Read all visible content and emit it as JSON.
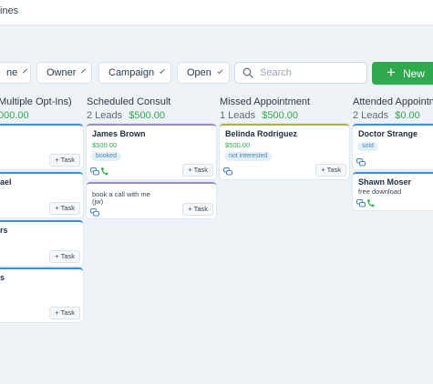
{
  "header": {
    "title": "ines"
  },
  "filters": {
    "chips": [
      {
        "key": "chip-0",
        "label": "ne"
      },
      {
        "key": "owner",
        "label": "Owner"
      },
      {
        "key": "campaign",
        "label": "Campaign"
      },
      {
        "key": "status",
        "label": "Open"
      }
    ],
    "search_placeholder": "Search",
    "new_label": "New"
  },
  "columns": [
    {
      "name": "Multiple Opt-Ins)",
      "count": "",
      "amount": "000.00",
      "cards": [
        {
          "name": "",
          "task": "+ Task"
        },
        {
          "name": "ael",
          "task": "+ Task"
        },
        {
          "name": "rs",
          "task": "+ Task"
        },
        {
          "name": "s",
          "task": "+ Task"
        }
      ]
    },
    {
      "name": "Scheduled Consult",
      "count": "2 Leads",
      "amount": "$500.00",
      "cards": [
        {
          "name": "James Brown",
          "value": "$500.00",
          "tag": "booked",
          "task": "+ Task"
        },
        {
          "note": "book a call with me (jw)",
          "task": "+ Task"
        }
      ]
    },
    {
      "name": "Missed Appointment",
      "count": "1 Leads",
      "amount": "$500.00",
      "cards": [
        {
          "name": "Belinda Rodriguez",
          "value": "$500.00",
          "tag": "not interested",
          "task": "+ Task"
        }
      ]
    },
    {
      "name": "Attended Appointm",
      "count": "2 Leads",
      "amount": "$0.00",
      "cards": [
        {
          "name": "Doctor Strange",
          "tag": "sold"
        },
        {
          "name": "Shawn Moser",
          "note": "free download"
        }
      ]
    }
  ],
  "colors": {
    "green": "#2eaa4d",
    "value_green": "#33a852",
    "card_blue": "#3d8fd8",
    "card_purple": "#9b8ec4",
    "card_olive": "#a9b24a"
  }
}
